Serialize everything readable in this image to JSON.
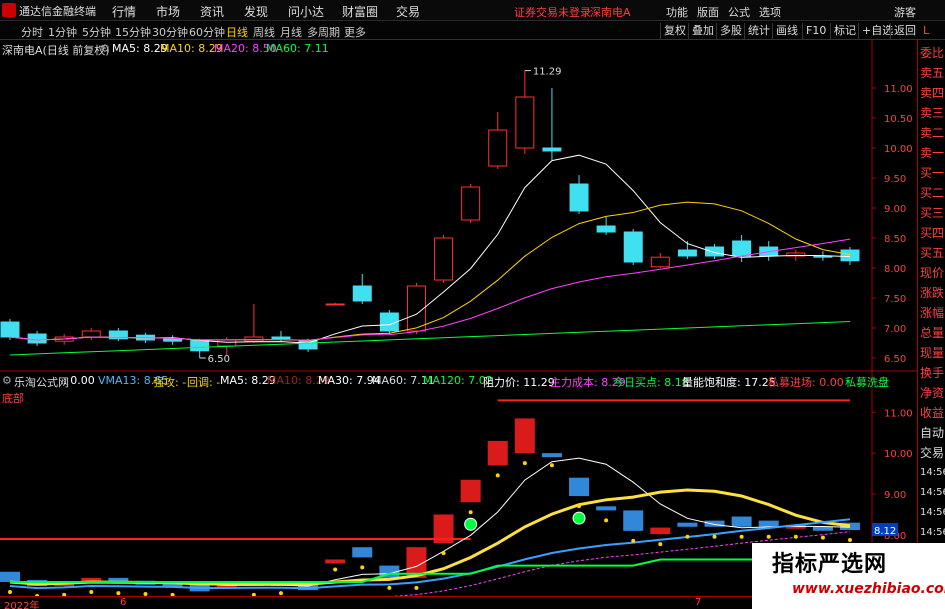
{
  "menubar": {
    "app_title": "通达信金融终端",
    "menus": [
      "行情",
      "市场",
      "资讯",
      "发现",
      "问小达",
      "财富圈",
      "交易"
    ],
    "notice": "证券交易未登录",
    "stock_name": "深南电A",
    "right_menus": [
      "功能",
      "版面",
      "公式",
      "选项"
    ],
    "guest": "游客"
  },
  "toolbar": {
    "periods": [
      "分时",
      "1分钟",
      "5分钟",
      "15分钟",
      "30分钟",
      "60分钟",
      "日线",
      "周线",
      "月线",
      "多周期",
      "更多"
    ],
    "active_period": "日线",
    "buttons": [
      "复权",
      "叠加",
      "多股",
      "统计",
      "画线",
      "F10",
      "标记",
      "+自选",
      "返回"
    ],
    "right_label": "L"
  },
  "main_legend": {
    "title": "深南电A(日线 前复权)",
    "ma5": "MA5: 8.29",
    "ma10": "MA10: 8.29",
    "ma20": "MA20: 8.50",
    "ma60": "MA60: 7.11",
    "colors": {
      "ma5": "#ffffff",
      "ma10": "#ffd400",
      "ma20": "#ff40ff",
      "ma60": "#00ff40"
    }
  },
  "sub_legend": {
    "title": "乐淘公式网",
    "v0": ": 0.00",
    "vma13": "VMA13: 8.65",
    "qianggong": "强攻: -",
    "huitiao": "回调: -",
    "ma5": "MA5: 8.29",
    "ma10": "MA10: 8.29",
    "ma30": "MA30: 7.94",
    "ma60": "MA60: 7.11",
    "ma120": "MA120: 7.02",
    "zuli": "阻力价: 11.29",
    "zhuli": "主力成本: 8.29",
    "jinri": "今日买点: 8.18",
    "liangneng": "量能饱和度: 17.25",
    "simu_in": "私募进场: 0.00",
    "simu_out": "私募洗盘",
    "label2": "底部"
  },
  "price_axis": {
    "main_ticks": [
      "11.00",
      "10.50",
      "10.00",
      "9.50",
      "9.00",
      "8.50",
      "8.00",
      "7.50",
      "7.00",
      "6.50"
    ],
    "sub_ticks": [
      "11.00",
      "10.00",
      "9.00",
      "8.00",
      "7.00"
    ],
    "high_label": "11.29",
    "low_label": "6.50",
    "current_tag": "8.12"
  },
  "right_panel": [
    "委比",
    "卖五",
    "卖四",
    "卖三",
    "卖二",
    "卖一",
    "买一",
    "买二",
    "买三",
    "买四",
    "买五",
    "现价",
    "涨跌",
    "涨幅",
    "总量",
    "现量",
    "换手",
    "净资",
    "收益",
    "自动",
    "交易",
    "14:56",
    "14:56",
    "14:56",
    "14:56",
    "14:56",
    "14:56",
    "14:56"
  ],
  "x_axis": [
    "2022年",
    "6",
    "7"
  ],
  "watermark": {
    "title": "指标严选网",
    "url": "www.xuezhibiao.com"
  },
  "chart_data": {
    "type": "candlestick",
    "title": "深南电A(日线 前复权)",
    "ylim": [
      6.3,
      11.5
    ],
    "high": 11.29,
    "low": 6.5,
    "candles": [
      {
        "o": 7.1,
        "c": 6.85,
        "h": 7.15,
        "l": 6.8
      },
      {
        "o": 6.9,
        "c": 6.75,
        "h": 6.95,
        "l": 6.7
      },
      {
        "o": 6.78,
        "c": 6.85,
        "h": 6.9,
        "l": 6.72
      },
      {
        "o": 6.85,
        "c": 6.95,
        "h": 7.0,
        "l": 6.8
      },
      {
        "o": 6.95,
        "c": 6.82,
        "h": 7.0,
        "l": 6.78
      },
      {
        "o": 6.88,
        "c": 6.8,
        "h": 6.92,
        "l": 6.75
      },
      {
        "o": 6.82,
        "c": 6.78,
        "h": 6.88,
        "l": 6.72
      },
      {
        "o": 6.8,
        "c": 6.62,
        "h": 6.82,
        "l": 6.5
      },
      {
        "o": 6.7,
        "c": 6.8,
        "h": 6.85,
        "l": 6.55
      },
      {
        "o": 6.78,
        "c": 6.85,
        "h": 7.4,
        "l": 6.75
      },
      {
        "o": 6.85,
        "c": 6.82,
        "h": 6.95,
        "l": 6.78
      },
      {
        "o": 6.8,
        "c": 6.65,
        "h": 6.82,
        "l": 6.6
      },
      {
        "o": 7.4,
        "c": 7.4,
        "h": 7.42,
        "l": 7.38
      },
      {
        "o": 7.7,
        "c": 7.45,
        "h": 7.9,
        "l": 7.4
      },
      {
        "o": 7.25,
        "c": 6.95,
        "h": 7.3,
        "l": 6.9
      },
      {
        "o": 6.95,
        "c": 7.7,
        "h": 7.75,
        "l": 6.9
      },
      {
        "o": 7.8,
        "c": 8.5,
        "h": 8.55,
        "l": 7.75
      },
      {
        "o": 8.8,
        "c": 9.35,
        "h": 9.4,
        "l": 8.75
      },
      {
        "o": 9.7,
        "c": 10.3,
        "h": 10.6,
        "l": 9.65
      },
      {
        "o": 10.0,
        "c": 10.85,
        "h": 11.29,
        "l": 9.9
      },
      {
        "o": 10.0,
        "c": 9.95,
        "h": 11.0,
        "l": 9.8
      },
      {
        "o": 9.4,
        "c": 8.95,
        "h": 9.55,
        "l": 8.9
      },
      {
        "o": 8.7,
        "c": 8.6,
        "h": 8.85,
        "l": 8.55
      },
      {
        "o": 8.6,
        "c": 8.1,
        "h": 8.65,
        "l": 8.05
      },
      {
        "o": 8.02,
        "c": 8.18,
        "h": 8.25,
        "l": 8.0
      },
      {
        "o": 8.3,
        "c": 8.2,
        "h": 8.45,
        "l": 8.15
      },
      {
        "o": 8.35,
        "c": 8.2,
        "h": 8.4,
        "l": 8.15
      },
      {
        "o": 8.45,
        "c": 8.2,
        "h": 8.55,
        "l": 8.1
      },
      {
        "o": 8.35,
        "c": 8.2,
        "h": 8.45,
        "l": 8.12
      },
      {
        "o": 8.2,
        "c": 8.25,
        "h": 8.3,
        "l": 8.12
      },
      {
        "o": 8.2,
        "c": 8.18,
        "h": 8.28,
        "l": 8.12
      },
      {
        "o": 8.3,
        "c": 8.12,
        "h": 8.35,
        "l": 8.05
      }
    ]
  }
}
